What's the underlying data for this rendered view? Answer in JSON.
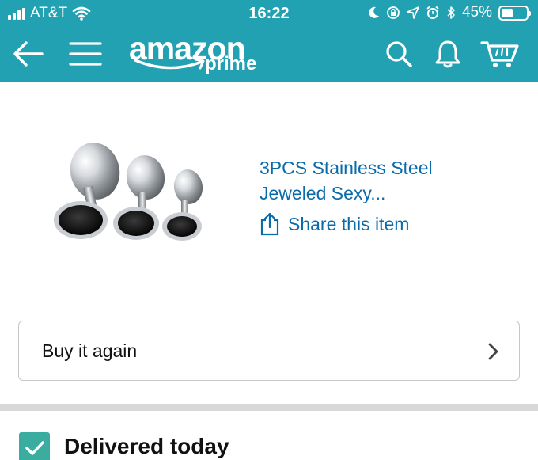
{
  "status_bar": {
    "carrier": "AT&T",
    "time": "16:22",
    "battery_percent": "45%",
    "battery_level": 0.45,
    "signal_bars": 4,
    "icons": [
      "wifi-icon",
      "moon-icon",
      "orientation-lock-icon",
      "location-arrow-icon",
      "alarm-icon",
      "bluetooth-icon",
      "battery-icon"
    ]
  },
  "nav": {
    "logo_main": "amazon",
    "logo_sub": "prime",
    "icons": [
      "back-arrow-icon",
      "hamburger-menu-icon",
      "search-icon",
      "bell-icon",
      "cart-icon"
    ]
  },
  "product": {
    "title_line1": "3PCS Stainless Steel",
    "title_line2": "Jeweled Sexy...",
    "share_label": "Share this item"
  },
  "buy_again": {
    "label": "Buy it again"
  },
  "delivery": {
    "status": "Delivered today"
  },
  "colors": {
    "header": "#21a1b1",
    "link": "#0a6bab",
    "check": "#3aada0"
  }
}
